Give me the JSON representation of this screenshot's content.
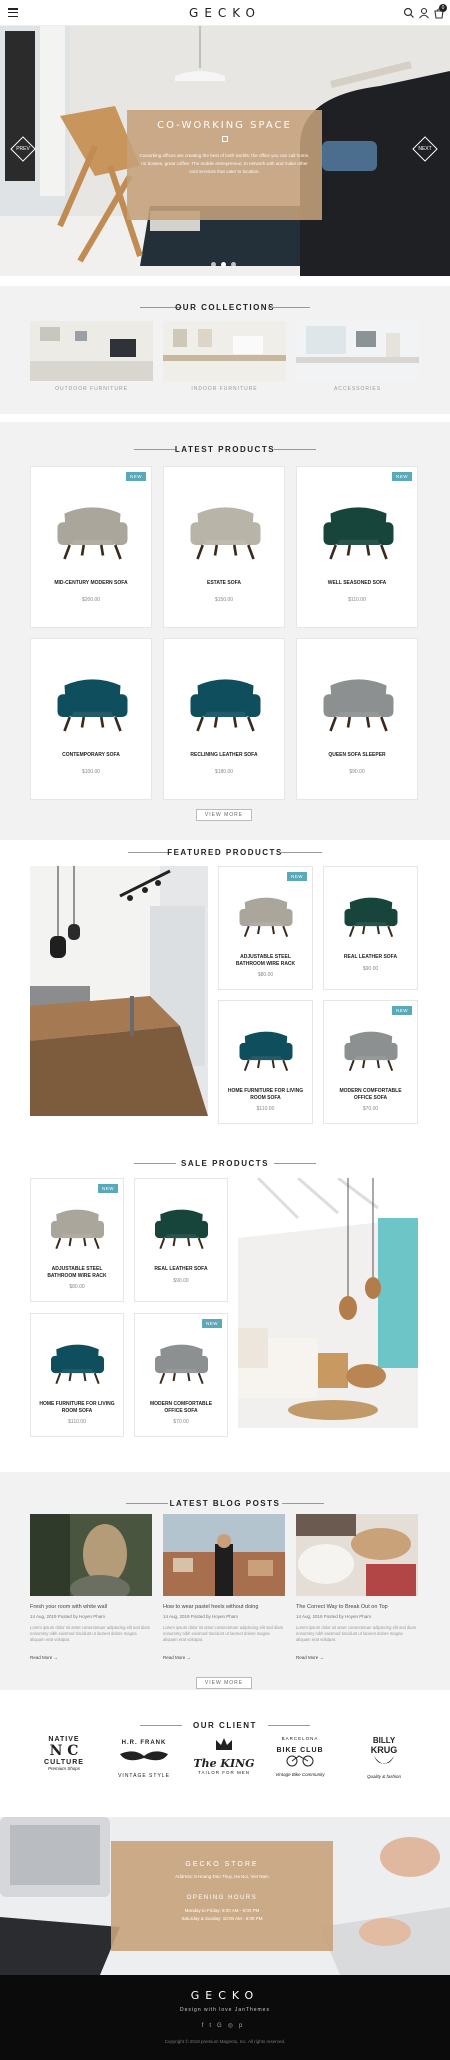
{
  "header": {
    "logo": "GECKO",
    "cart_count": "0"
  },
  "hero": {
    "title": "CO-WORKING SPACE",
    "text": "Coworking offices are creating the best of both worlds: the office you can call home, no bosses, great coffee. The mobile entrepreneur, to network with and make other cool services that cater to location.",
    "prev": "PREV",
    "next": "NEXT"
  },
  "collections": {
    "title": "OUR COLLECTIONS",
    "items": [
      {
        "label": "OUTDOOR FURNITURE"
      },
      {
        "label": "INDOOR FURNITURE"
      },
      {
        "label": "ACCESSORIES"
      }
    ]
  },
  "latest": {
    "title": "LATEST PRODUCTS",
    "view_more": "VIEW MORE",
    "badge": "NEW",
    "products": [
      {
        "name": "MID-CENTURY MODERN SOFA",
        "price": "$200.00",
        "new": true,
        "color": "#aaa69b"
      },
      {
        "name": "ESTATE SOFA",
        "price": "$150.00",
        "new": false,
        "color": "#b9b4a8"
      },
      {
        "name": "WELL SEASONED SOFA",
        "price": "$110.00",
        "new": true,
        "color": "#17453c"
      },
      {
        "name": "CONTEMPORARY SOFA",
        "price": "$100.00",
        "new": false,
        "color": "#0f4e5c"
      },
      {
        "name": "RECLINING LEATHER SOFA",
        "price": "$180.00",
        "new": false,
        "color": "#0f4e5c"
      },
      {
        "name": "QUEEN SOFA SLEEPER",
        "price": "$90.00",
        "new": false,
        "color": "#8d9090"
      }
    ]
  },
  "featured": {
    "title": "FEATURED PRODUCTS",
    "badge": "NEW",
    "products": [
      {
        "name": "ADJUSTABLE STEEL BATHROOM WIRE RACK",
        "price": "$80.00",
        "new": true,
        "color": "#aaa69b"
      },
      {
        "name": "REAL LEATHER SOFA",
        "price": "$90.00",
        "new": false,
        "color": "#17453c"
      },
      {
        "name": "HOME FURNITURE FOR LIVING ROOM SOFA",
        "price": "$110.00",
        "new": false,
        "color": "#0f4e5c"
      },
      {
        "name": "MODERN COMFORTABLE OFFICE SOFA",
        "price": "$70.00",
        "new": true,
        "color": "#8d9090"
      }
    ]
  },
  "sale": {
    "title": "SALE PRODUCTS",
    "badge": "NEW",
    "products": [
      {
        "name": "ADJUSTABLE STEEL BATHROOM WIRE RACK",
        "price": "$80.00",
        "new": true,
        "color": "#aaa69b"
      },
      {
        "name": "REAL LEATHER SOFA",
        "price": "$90.00",
        "new": false,
        "color": "#17453c"
      },
      {
        "name": "HOME FURNITURE FOR LIVING ROOM SOFA",
        "price": "$110.00",
        "new": false,
        "color": "#0f4e5c"
      },
      {
        "name": "MODERN COMFORTABLE OFFICE SOFA",
        "price": "$70.00",
        "new": true,
        "color": "#8d9090"
      }
    ]
  },
  "blog": {
    "title": "LATEST BLOG POSTS",
    "view_more": "VIEW MORE",
    "posts": [
      {
        "title": "Fresh your room with white wall",
        "meta": "14 Aug, 2019 Posted by Hoyen Pham",
        "excerpt": "Lorem ipsum dolor sit amet consectetuer adipiscing elit sed diam nonummy nibh euismod tincidunt ut laoreet dolore magna aliquam erat volutpat.",
        "more": "Read More"
      },
      {
        "title": "How to wear pastel heels without doing",
        "meta": "14 Aug, 2019 Posted by Hoyen Pham",
        "excerpt": "Lorem ipsum dolor sit amet consectetuer adipiscing elit sed diam nonummy nibh euismod tincidunt ut laoreet dolore magna aliquam erat volutpat.",
        "more": "Read More"
      },
      {
        "title": "The Correct Way to Break Out on Top",
        "meta": "14 Aug, 2019 Posted by Hoyen Pham",
        "excerpt": "Lorem ipsum dolor sit amet consectetuer adipiscing elit sed diam nonummy nibh euismod tincidunt ut laoreet dolore magna aliquam erat volutpat.",
        "more": "Read More"
      }
    ]
  },
  "clients": {
    "title": "OUR CLIENT",
    "items": [
      {
        "top": "NATIVE",
        "main": "N C",
        "bottom": "CULTURE",
        "sub": "Premium Shops"
      },
      {
        "top": "H.R. FRANK",
        "main": "",
        "bottom": "VINTAGE STYLE",
        "sub": ""
      },
      {
        "top": "",
        "main": "The KING",
        "bottom": "TAILOR FOR MEN",
        "sub": ""
      },
      {
        "top": "BARCELONA",
        "main": "BIKE CLUB",
        "bottom": "",
        "sub": "Vintage Bike Community"
      },
      {
        "top": "BILLY",
        "main": "KRUG",
        "bottom": "",
        "sub": "Quality & fashion"
      }
    ]
  },
  "store": {
    "title": "GECKO STORE",
    "address": "Address: 8 Hoang Dao Thuy, Ha Noi, Viet Nam",
    "hours_title": "OPENING HOURS",
    "hours_1": "Monday to Friday: 9:00 AM - 9:00 PM",
    "hours_2": "Saturday & Sunday: 10:00 AM - 5:00 PM"
  },
  "footer": {
    "logo": "GECKO",
    "tagline": "Design with love JanThemes",
    "copyright": "Copyright © 2019 premium Magento, Inc. All rights reserved."
  }
}
